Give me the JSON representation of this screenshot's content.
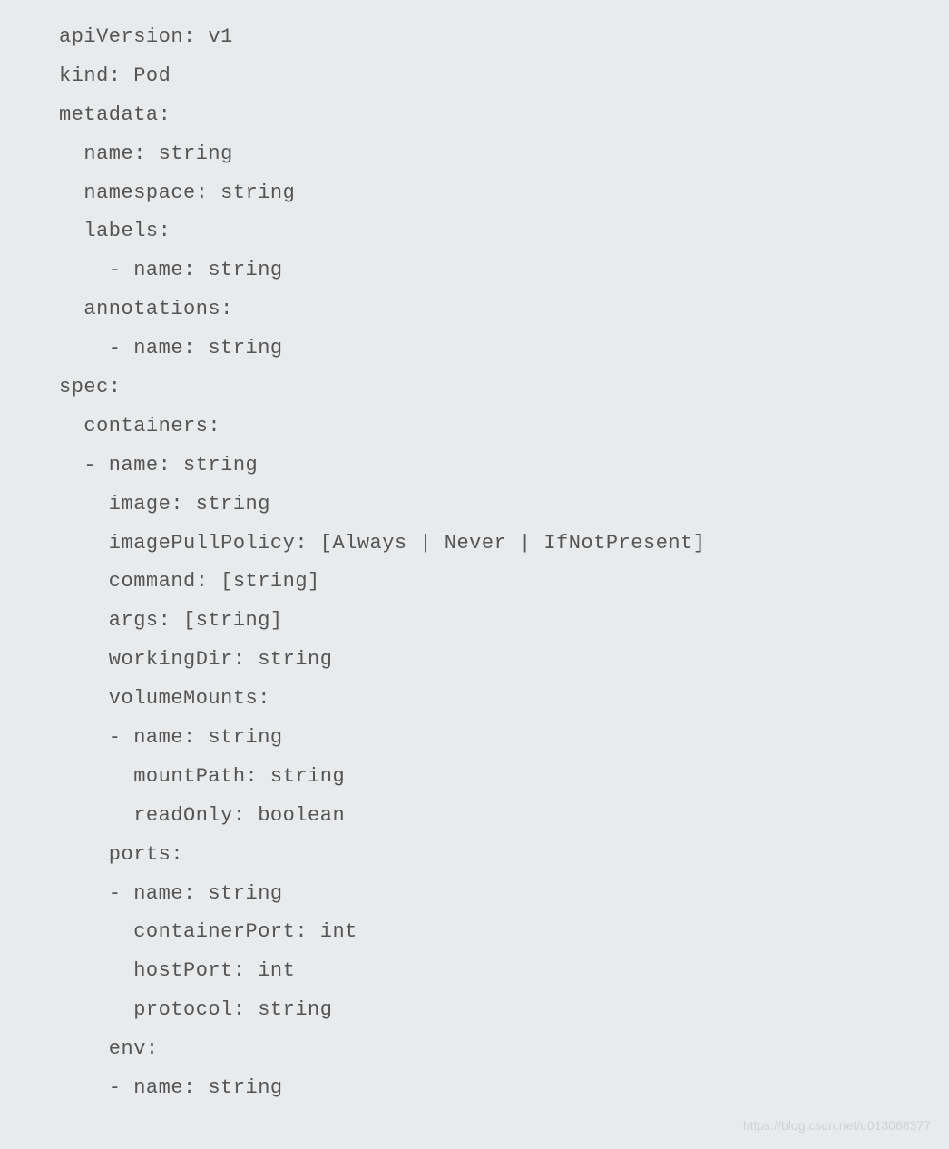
{
  "lines": [
    "apiVersion: v1",
    "kind: Pod",
    "metadata:",
    "  name: string",
    "  namespace: string",
    "  labels:",
    "    - name: string",
    "  annotations:",
    "    - name: string",
    "spec:",
    "  containers:",
    "  - name: string",
    "    image: string",
    "    imagePullPolicy: [Always | Never | IfNotPresent]",
    "    command: [string]",
    "    args: [string]",
    "    workingDir: string",
    "    volumeMounts:",
    "    - name: string",
    "      mountPath: string",
    "      readOnly: boolean",
    "    ports:",
    "    - name: string",
    "      containerPort: int",
    "      hostPort: int",
    "      protocol: string",
    "    env:",
    "    - name: string"
  ],
  "watermark": "https://blog.csdn.net/u013068377"
}
